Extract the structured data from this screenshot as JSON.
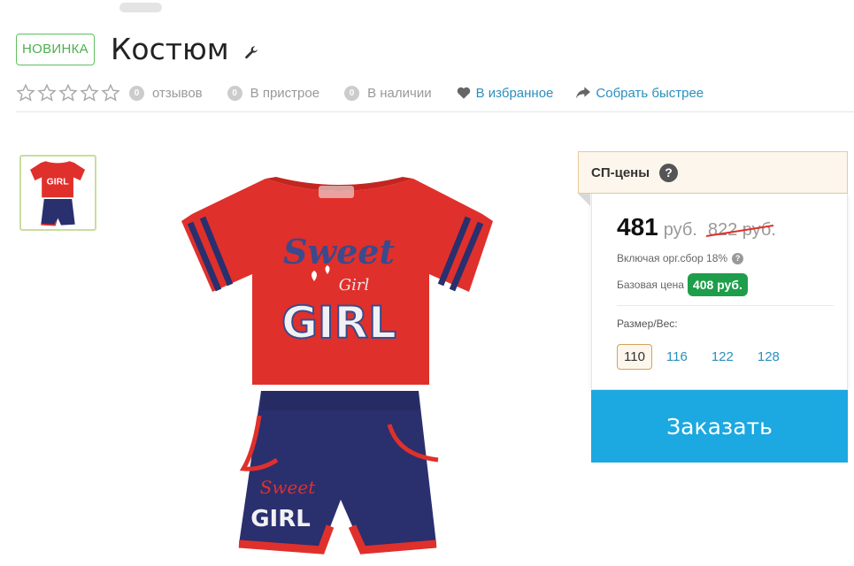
{
  "header": {
    "badge": "НОВИНКА",
    "title": "Костюм"
  },
  "meta": {
    "reviews_count": "0",
    "reviews_label": "отзывов",
    "pristroy_count": "0",
    "pristroy_label": "В пристрое",
    "stock_count": "0",
    "stock_label": "В наличии",
    "favorite_label": "В избранное",
    "faster_label": "Собрать быстрее"
  },
  "price_card": {
    "header": "СП-цены",
    "help": "?",
    "price": "481",
    "currency": "руб.",
    "old_price": "822 руб.",
    "included_fee": "Включая орг.сбор 18%",
    "base_price_label": "Базовая цена",
    "base_price": "408 руб.",
    "size_label": "Размер/Вес:",
    "sizes": [
      "110",
      "116",
      "122",
      "128"
    ],
    "selected_size": "110",
    "order_button": "Заказать"
  },
  "product_print": {
    "line1": "Sweet",
    "line2": "Girl",
    "line3": "GIRL"
  },
  "colors": {
    "accent_blue": "#1ca8e0",
    "link_blue": "#2a8fbd",
    "green_badge": "#1e9e4a",
    "new_badge_green": "#4caf50",
    "shirt_red": "#e0302b",
    "shorts_navy": "#2a2f6e"
  }
}
